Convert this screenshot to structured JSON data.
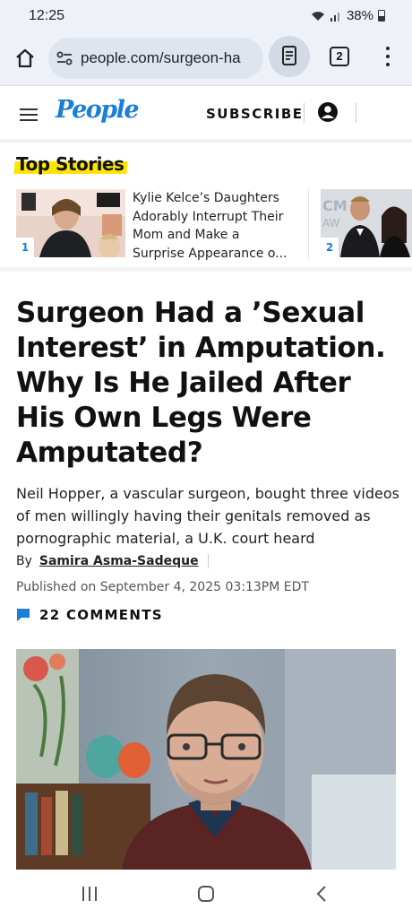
{
  "status_bar": {
    "time": "12:25",
    "battery": "38%"
  },
  "browser": {
    "url": "people.com/surgeon-ha",
    "tab_count": "2"
  },
  "site_header": {
    "logo": "People",
    "subscribe_label": "SUBSCRIBE"
  },
  "top_stories": {
    "title": "Top Stories",
    "items": [
      {
        "rank": "1",
        "title": "Kylie Kelce’s Daughters Adorably Interrupt Their Mom and Make a Surprise Appearance o..."
      },
      {
        "rank": "2",
        "title": ""
      }
    ]
  },
  "article": {
    "headline": "Surgeon Had a ’Sexual Interest’ in Amputation. Why Is He Jailed After His Own Legs Were Amputated?",
    "dek": "Neil Hopper, a vascular surgeon, bought three videos of men willingly having their genitals removed as pornographic material, a U.K. court heard",
    "by_label": "By",
    "author": "Samira Asma-Sadeque",
    "published": "Published on September 4, 2025 03:13PM EDT",
    "comments_label": "22 COMMENTS"
  },
  "colors": {
    "brand_blue": "#1b7fd6",
    "highlight_yellow": "#ffe600"
  }
}
